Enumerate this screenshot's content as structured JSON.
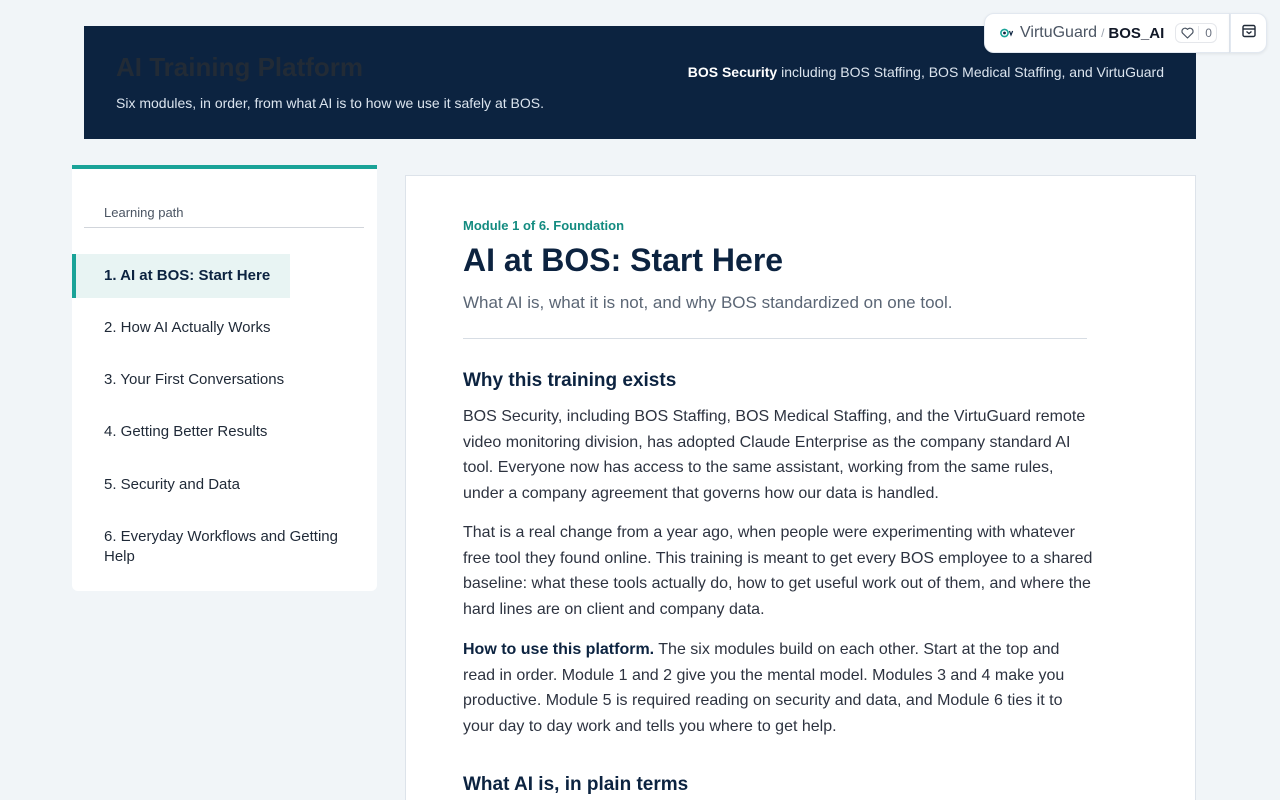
{
  "banner": {
    "title": "AI Training Platform",
    "subtitle": "Six modules, in order, from what AI is to how we use it safely at BOS.",
    "company_name": "BOS Security",
    "company_rest": " including BOS Staffing, BOS Medical Staffing, and VirtuGuard"
  },
  "breadcrumb": {
    "org": "VirtuGuard",
    "separator": "/",
    "project": "BOS_AI",
    "like_count": "0",
    "org_icon": "virtuguard-logo-icon",
    "like_icon": "heart-icon",
    "action_icon": "archive-box-icon"
  },
  "sidebar": {
    "heading": "Learning path",
    "items": [
      {
        "label": "1. AI at BOS: Start Here",
        "active": true
      },
      {
        "label": "2. How AI Actually Works",
        "active": false
      },
      {
        "label": "3. Your First Conversations",
        "active": false
      },
      {
        "label": "4. Getting Better Results",
        "active": false
      },
      {
        "label": "5. Security and Data",
        "active": false
      },
      {
        "label": "6. Everyday Workflows and Getting Help",
        "active": false
      }
    ]
  },
  "main": {
    "eyebrow": "Module 1 of 6. Foundation",
    "title": "AI at BOS: Start Here",
    "subtitle": "What AI is, what it is not, and why BOS standardized on one tool.",
    "sections": [
      {
        "heading": "Why this training exists",
        "paragraphs": [
          "BOS Security, including BOS Staffing, BOS Medical Staffing, and the VirtuGuard remote video monitoring division, has adopted Claude Enterprise as the company standard AI tool. Everyone now has access to the same assistant, working from the same rules, under a company agreement that governs how our data is handled.",
          "That is a real change from a year ago, when people were experimenting with whatever free tool they found online. This training is meant to get every BOS employee to a shared baseline: what these tools actually do, how to get useful work out of them, and where the hard lines are on client and company data."
        ],
        "lead_bold": "How to use this platform.",
        "lead_rest": " The six modules build on each other. Start at the top and read in order. Module 1 and 2 give you the mental model. Modules 3 and 4 make you productive. Module 5 is required reading on security and data, and Module 6 ties it to your day to day work and tells you where to get help."
      },
      {
        "heading": "What AI is, in plain terms"
      }
    ]
  },
  "colors": {
    "banner_bg": "#0c2340",
    "accent": "#1aa398",
    "page_bg": "#f1f5f8"
  }
}
